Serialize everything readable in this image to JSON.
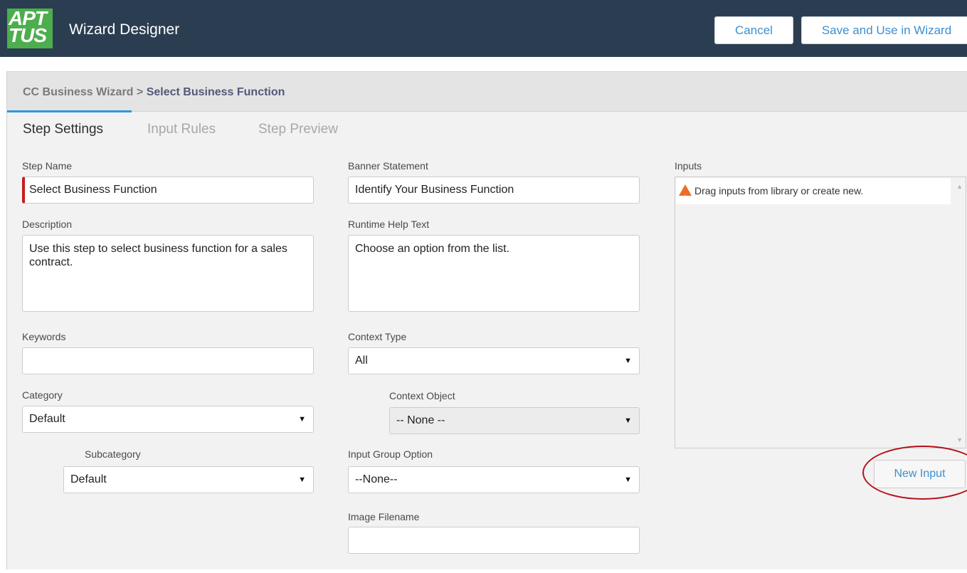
{
  "header": {
    "logo_line1": "APT",
    "logo_line2": "TUS",
    "title": "Wizard Designer",
    "cancel_label": "Cancel",
    "save_label": "Save and Use in Wizard"
  },
  "breadcrumb": {
    "parent": "CC Business Wizard",
    "separator": ">",
    "current": "Select Business Function"
  },
  "tabs": [
    {
      "label": "Step Settings",
      "active": true
    },
    {
      "label": "Input Rules",
      "active": false
    },
    {
      "label": "Step Preview",
      "active": false
    }
  ],
  "form": {
    "step_name": {
      "label": "Step Name",
      "value": "Select Business Function"
    },
    "description": {
      "label": "Description",
      "value": "Use this step to select business function for a sales contract."
    },
    "keywords": {
      "label": "Keywords",
      "value": ""
    },
    "category": {
      "label": "Category",
      "value": "Default"
    },
    "subcategory": {
      "label": "Subcategory",
      "value": "Default"
    },
    "banner_statement": {
      "label": "Banner Statement",
      "value": "Identify Your Business Function"
    },
    "runtime_help": {
      "label": "Runtime Help Text",
      "value": "Choose an option from the list."
    },
    "context_type": {
      "label": "Context Type",
      "value": "All"
    },
    "context_object": {
      "label": "Context Object",
      "value": "-- None --"
    },
    "input_group_option": {
      "label": "Input Group Option",
      "value": "--None--"
    },
    "image_filename": {
      "label": "Image Filename",
      "value": ""
    }
  },
  "inputs": {
    "label": "Inputs",
    "empty_message": "Drag inputs from library or create new.",
    "new_input_label": "New Input"
  },
  "colors": {
    "header_bg": "#2b3e51",
    "logo_green": "#4cae4c",
    "link_blue": "#3e8fce",
    "required_red": "#c61d23",
    "tab_active_underline": "#2b9ad6",
    "highlight_ring": "#b5121b"
  }
}
